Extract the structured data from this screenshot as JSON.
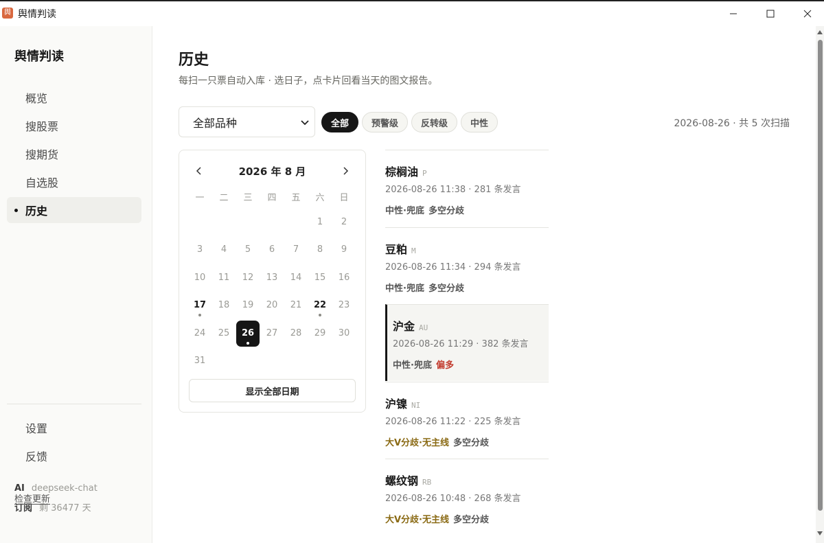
{
  "window": {
    "icon_glyph": "舆",
    "title": "舆情判读"
  },
  "sidebar": {
    "brand": "舆情判读",
    "items": [
      {
        "label": "概览"
      },
      {
        "label": "搜股票"
      },
      {
        "label": "搜期货"
      },
      {
        "label": "自选股"
      },
      {
        "label": "历史",
        "active": true
      }
    ],
    "bottom_items": [
      {
        "label": "设置"
      },
      {
        "label": "反馈"
      }
    ],
    "ai_label": "AI",
    "ai_value": "deepseek-chat",
    "sub_label": "订阅",
    "sub_value": "剩 36477 天",
    "check_update": "检查更新"
  },
  "main": {
    "title": "历史",
    "subtitle": "每扫一只票自动入库 · 选日子，点卡片回看当天的图文报告。",
    "select_value": "全部品种",
    "filters": [
      {
        "label": "全部",
        "active": true
      },
      {
        "label": "预警级"
      },
      {
        "label": "反转级"
      },
      {
        "label": "中性"
      }
    ],
    "scan_info": "2026-08-26 · 共 5 次扫描"
  },
  "calendar": {
    "month_label": "2026 年 8 月",
    "weekdays": [
      "一",
      "二",
      "三",
      "四",
      "五",
      "六",
      "日"
    ],
    "days_with_scans": [
      17,
      22,
      26
    ],
    "selected_day": 26,
    "show_all_label": "显示全部日期"
  },
  "scans": [
    {
      "name": "棕榈油",
      "code": "P",
      "time": "2026-08-26 11:38 · 281 条发言",
      "tags": [
        {
          "text": "中性·兜底",
          "tone": "neutral"
        },
        {
          "text": "多空分歧",
          "tone": "neutral"
        }
      ]
    },
    {
      "name": "豆粕",
      "code": "M",
      "time": "2026-08-26 11:34 · 294 条发言",
      "tags": [
        {
          "text": "中性·兜底",
          "tone": "neutral"
        },
        {
          "text": "多空分歧",
          "tone": "neutral"
        }
      ]
    },
    {
      "name": "沪金",
      "code": "AU",
      "time": "2026-08-26 11:29 · 382 条发言",
      "active": true,
      "tags": [
        {
          "text": "中性·兜底",
          "tone": "neutral"
        },
        {
          "text": "偏多",
          "tone": "red"
        }
      ]
    },
    {
      "name": "沪镍",
      "code": "NI",
      "time": "2026-08-26 11:22 · 225 条发言",
      "tags": [
        {
          "text": "大V分歧·无主线",
          "tone": "gold"
        },
        {
          "text": "多空分歧",
          "tone": "neutral"
        }
      ]
    },
    {
      "name": "螺纹钢",
      "code": "RB",
      "time": "2026-08-26 10:48 · 268 条发言",
      "tags": [
        {
          "text": "大V分歧·无主线",
          "tone": "gold"
        },
        {
          "text": "多空分歧",
          "tone": "neutral"
        }
      ]
    }
  ]
}
